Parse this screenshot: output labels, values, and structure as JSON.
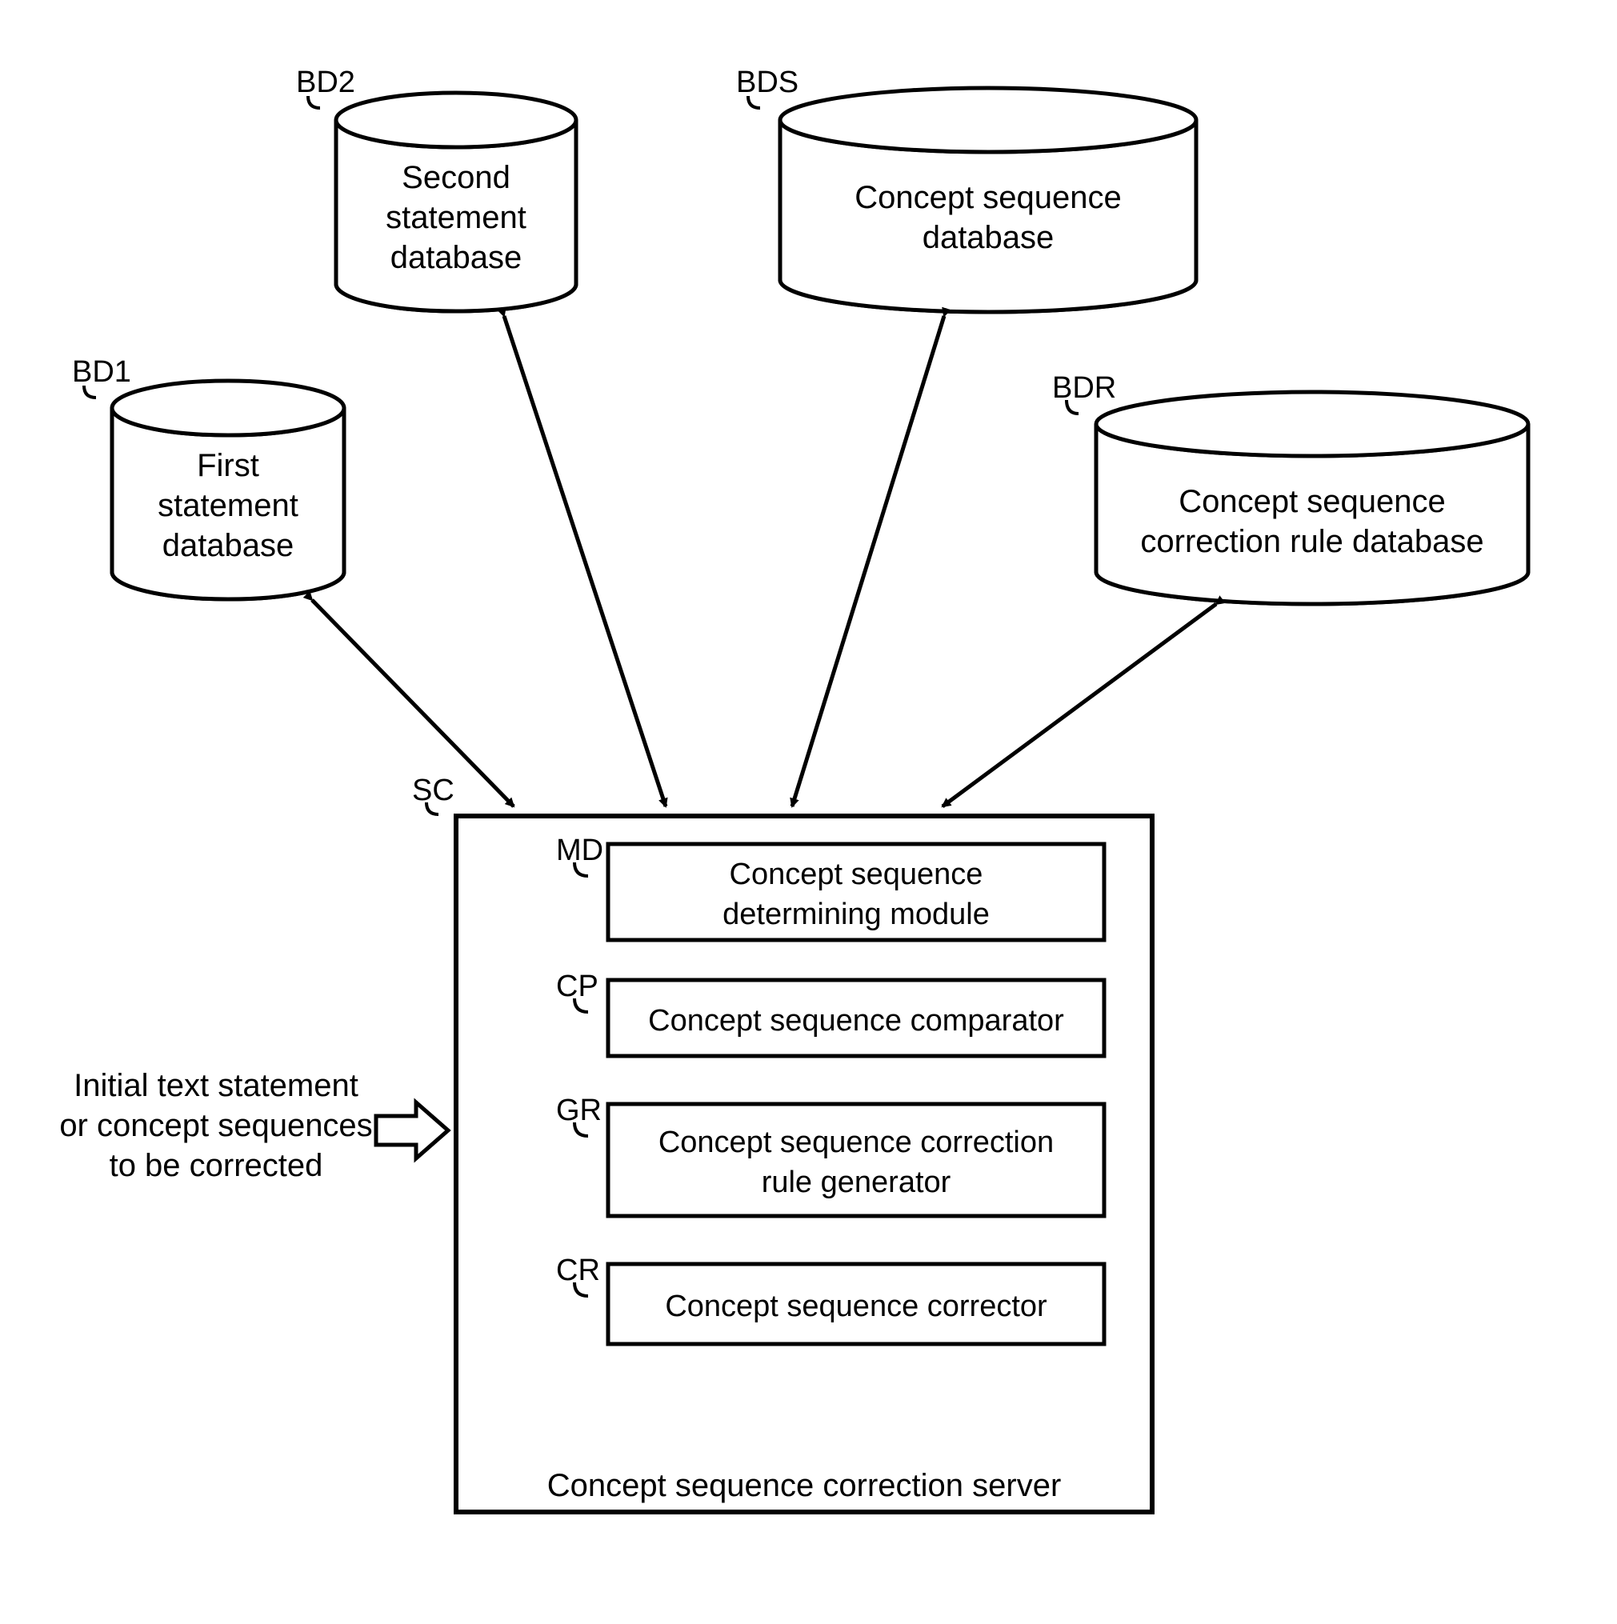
{
  "databases": {
    "bd1": {
      "tag": "BD1",
      "line1": "First",
      "line2": "statement",
      "line3": "database"
    },
    "bd2": {
      "tag": "BD2",
      "line1": "Second",
      "line2": "statement",
      "line3": "database"
    },
    "bds": {
      "tag": "BDS",
      "line1": "Concept sequence",
      "line2": "database"
    },
    "bdr": {
      "tag": "BDR",
      "line1": "Concept sequence",
      "line2": "correction rule database"
    }
  },
  "server": {
    "tag": "SC",
    "title": "Concept sequence correction server",
    "modules": {
      "md": {
        "tag": "MD",
        "line1": "Concept sequence",
        "line2": "determining module"
      },
      "cp": {
        "tag": "CP",
        "line1": "Concept sequence comparator"
      },
      "gr": {
        "tag": "GR",
        "line1": "Concept sequence correction",
        "line2": "rule generator"
      },
      "cr": {
        "tag": "CR",
        "line1": "Concept sequence corrector"
      }
    }
  },
  "input": {
    "line1": "Initial text statement",
    "line2": "or concept sequences",
    "line3": "to be corrected"
  }
}
